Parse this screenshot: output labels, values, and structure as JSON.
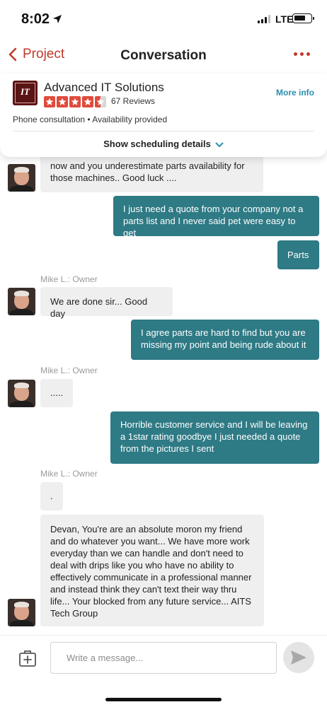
{
  "status": {
    "time": "8:02",
    "network": "LTE"
  },
  "nav": {
    "back_label": "Project",
    "title": "Conversation"
  },
  "business": {
    "name": "Advanced IT Solutions",
    "logo_text": "IT",
    "rating": 4.5,
    "reviews": "67 Reviews",
    "more_info": "More info",
    "subline": "Phone consultation • Availability provided",
    "scheduling": "Show scheduling details"
  },
  "messages": [
    {
      "type": "in",
      "text": "now and you underestimate parts availability for those machines.. Good luck ...."
    },
    {
      "type": "out",
      "text": "I just need a quote from your company not a parts list and I never said pet were easy to get"
    },
    {
      "type": "out",
      "text": "Parts"
    },
    {
      "type": "in",
      "sender": "Mike L.: Owner",
      "text": "We are done sir... Good day"
    },
    {
      "type": "out",
      "text": "I agree parts are hard to find but you are missing my point and being rude about it"
    },
    {
      "type": "in",
      "sender": "Mike L.: Owner",
      "text": "....."
    },
    {
      "type": "out",
      "text": "Horrible customer service and I will be leaving a 1star rating goodbye I just needed a quote from the pictures I sent"
    },
    {
      "type": "in",
      "sender": "Mike L.: Owner",
      "text": "."
    },
    {
      "type": "in",
      "text": "Devan, You're are an absolute moron my friend and do whatever you want... We have more work everyday than we can handle and don't need to deal with drips like you who have no ability to effectively communicate in a professional manner and instead think they can't text their way thru life... Your blocked from any future service... AITS Tech Group"
    }
  ],
  "composer": {
    "placeholder": "Write a message..."
  },
  "colors": {
    "accent": "#c0392b",
    "outgoing_bubble": "#2e7a85",
    "link": "#2b8fb0",
    "incoming_bubble": "#efefef"
  },
  "icons": [
    "location-arrow-icon",
    "signal-icon",
    "battery-icon",
    "chevron-left-icon",
    "more-dots-icon",
    "star-icon",
    "chevron-down-icon",
    "attach-icon",
    "send-icon"
  ]
}
